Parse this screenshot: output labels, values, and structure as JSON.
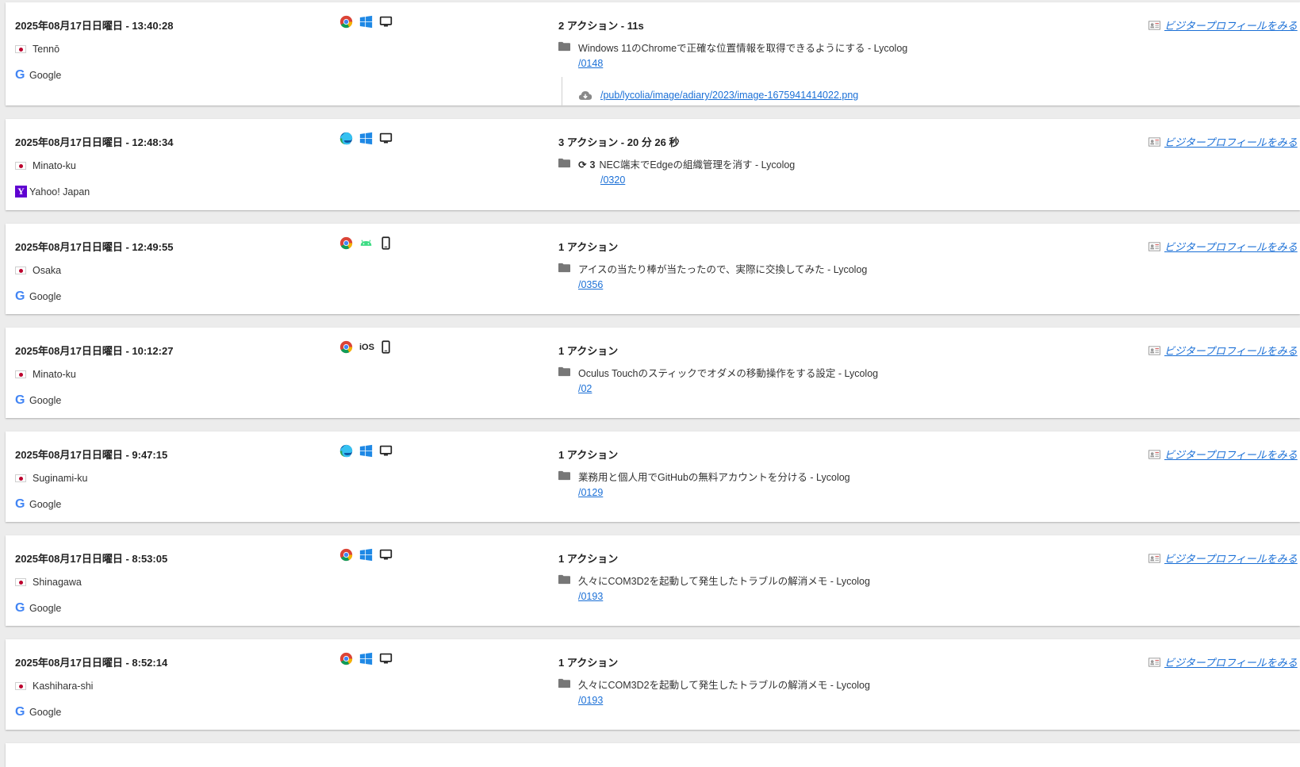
{
  "visits": [
    {
      "timestamp": "2025年08月17日日曜日 - 13:40:28",
      "location": "Tennō",
      "referrer": "Google",
      "referrer_icon": "google-icon",
      "browser_icon": "chrome-icon",
      "os_icon": "windows-icon",
      "device_icon": "desktop-icon",
      "action_summary": "2 アクション - 11s",
      "actions": [
        {
          "title": "Windows 11のChromeで正確な位置情報を取得できるようにする - Lycolog",
          "path": "/0148"
        }
      ],
      "download": "/pub/lycolia/image/adiary/2023/image-1675941414022.png",
      "profile_label": "ビジタープロフィールをみる"
    },
    {
      "timestamp": "2025年08月17日日曜日 - 12:48:34",
      "location": "Minato-ku",
      "referrer": "Yahoo! Japan",
      "referrer_icon": "yahoo-icon",
      "browser_icon": "edge-icon",
      "os_icon": "windows-icon",
      "device_icon": "desktop-icon",
      "action_summary": "3 アクション - 20 分 26 秒",
      "actions": [
        {
          "reload": "3",
          "title": "NEC端末でEdgeの組織管理を消す - Lycolog",
          "path": "/0320"
        }
      ],
      "profile_label": "ビジタープロフィールをみる"
    },
    {
      "timestamp": "2025年08月17日日曜日 - 12:49:55",
      "location": "Osaka",
      "referrer": "Google",
      "referrer_icon": "google-icon",
      "browser_icon": "chrome-icon",
      "os_icon": "android-icon",
      "device_icon": "smartphone-icon",
      "action_summary": "1 アクション",
      "actions": [
        {
          "title": "アイスの当たり棒が当たったので、実際に交換してみた - Lycolog",
          "path": "/0356"
        }
      ],
      "profile_label": "ビジタープロフィールをみる"
    },
    {
      "timestamp": "2025年08月17日日曜日 - 10:12:27",
      "location": "Minato-ku",
      "referrer": "Google",
      "referrer_icon": "google-icon",
      "browser_icon": "chrome-icon",
      "os_icon": "ios-label",
      "os_label": "iOS",
      "device_icon": "smartphone-icon",
      "action_summary": "1 アクション",
      "actions": [
        {
          "title": "Oculus Touchのスティックでオダメの移動操作をする設定 - Lycolog",
          "path": "/02"
        }
      ],
      "profile_label": "ビジタープロフィールをみる"
    },
    {
      "timestamp": "2025年08月17日日曜日 - 9:47:15",
      "location": "Suginami-ku",
      "referrer": "Google",
      "referrer_icon": "google-icon",
      "browser_icon": "edge-icon",
      "os_icon": "windows-icon",
      "device_icon": "desktop-icon",
      "action_summary": "1 アクション",
      "actions": [
        {
          "title": "業務用と個人用でGitHubの無料アカウントを分ける - Lycolog",
          "path": "/0129"
        }
      ],
      "profile_label": "ビジタープロフィールをみる"
    },
    {
      "timestamp": "2025年08月17日日曜日 - 8:53:05",
      "location": "Shinagawa",
      "referrer": "Google",
      "referrer_icon": "google-icon",
      "browser_icon": "chrome-icon",
      "os_icon": "windows-icon",
      "device_icon": "desktop-icon",
      "action_summary": "1 アクション",
      "actions": [
        {
          "title": "久々にCOM3D2を起動して発生したトラブルの解消メモ - Lycolog",
          "path": "/0193"
        }
      ],
      "profile_label": "ビジタープロフィールをみる"
    },
    {
      "timestamp": "2025年08月17日日曜日 - 8:52:14",
      "location": "Kashihara-shi",
      "referrer": "Google",
      "referrer_icon": "google-icon",
      "browser_icon": "chrome-icon",
      "os_icon": "windows-icon",
      "device_icon": "desktop-icon",
      "action_summary": "1 アクション",
      "actions": [
        {
          "title": "久々にCOM3D2を起動して発生したトラブルの解消メモ - Lycolog",
          "path": "/0193"
        }
      ],
      "profile_label": "ビジタープロフィールをみる"
    }
  ]
}
